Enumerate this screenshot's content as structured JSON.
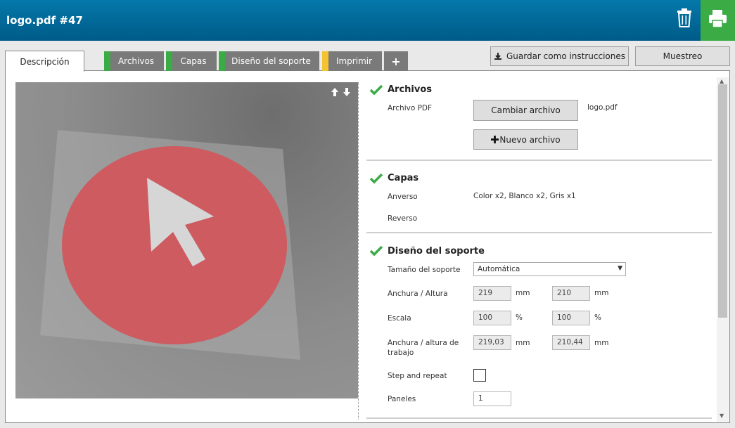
{
  "header": {
    "title": "logo.pdf #47"
  },
  "tabs": [
    {
      "label": "Descripción",
      "active": true
    },
    {
      "label": "Archivos",
      "status_color": "#3bab46"
    },
    {
      "label": "Capas",
      "status_color": "#3bab46"
    },
    {
      "label": "Diseño del soporte",
      "status_color": "#3bab46"
    },
    {
      "label": "Imprimir",
      "status_color": "#f4c430"
    },
    {
      "label": "+"
    }
  ],
  "actions": {
    "save_label": "Guardar como instrucciones",
    "proof_label": "Muestreo"
  },
  "archivos": {
    "title": "Archivos",
    "pdf_label": "Archivo PDF",
    "change_button": "Cambiar archivo",
    "filename": "logo.pdf",
    "new_button": "Nuevo archivo"
  },
  "capas": {
    "title": "Capas",
    "front_label": "Anverso",
    "front_value": "Color x2, Blanco x2, Gris x1",
    "back_label": "Reverso"
  },
  "diseno": {
    "title": "Diseño del soporte",
    "size_label": "Tamaño del soporte",
    "size_value": "Automática",
    "wh_label": "Anchura / Altura",
    "width": "219",
    "height": "210",
    "scale_label": "Escala",
    "scale_x": "100",
    "scale_y": "100",
    "work_label": "Anchura / altura de trabajo",
    "work_w": "219,03",
    "work_h": "210,44",
    "step_label": "Step and repeat",
    "panels_label": "Paneles",
    "panels_value": "1",
    "unit_mm": "mm",
    "unit_pct": "%"
  },
  "colors": {
    "header": "#0478aa",
    "print_button": "#3bab46",
    "ok_check": "#3bab46",
    "artwork_red": "#cd5b60"
  }
}
